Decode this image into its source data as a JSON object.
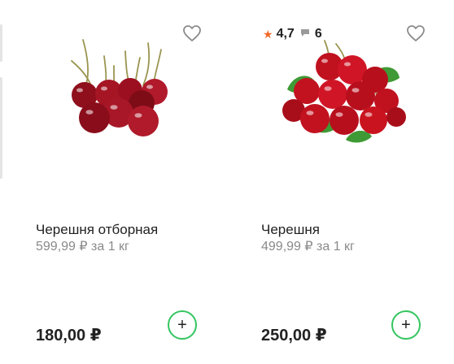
{
  "colors": {
    "accent_green": "#34c560",
    "star_orange": "#f0692a",
    "muted_text": "#8a8a8a"
  },
  "products": [
    {
      "name": "Черешня отборная",
      "unit_price": "599,99 ₽ за 1 кг",
      "price": "180,00 ₽",
      "add_label": "+",
      "favorite_icon": "heart-outline-icon",
      "image": "cherries-photo"
    },
    {
      "name": "Черешня",
      "unit_price": "499,99 ₽ за 1 кг",
      "price": "250,00 ₽",
      "add_label": "+",
      "favorite_icon": "heart-outline-icon",
      "image": "cherries-with-leaves-photo",
      "rating": {
        "value": "4,7",
        "reviews": "6"
      }
    }
  ]
}
